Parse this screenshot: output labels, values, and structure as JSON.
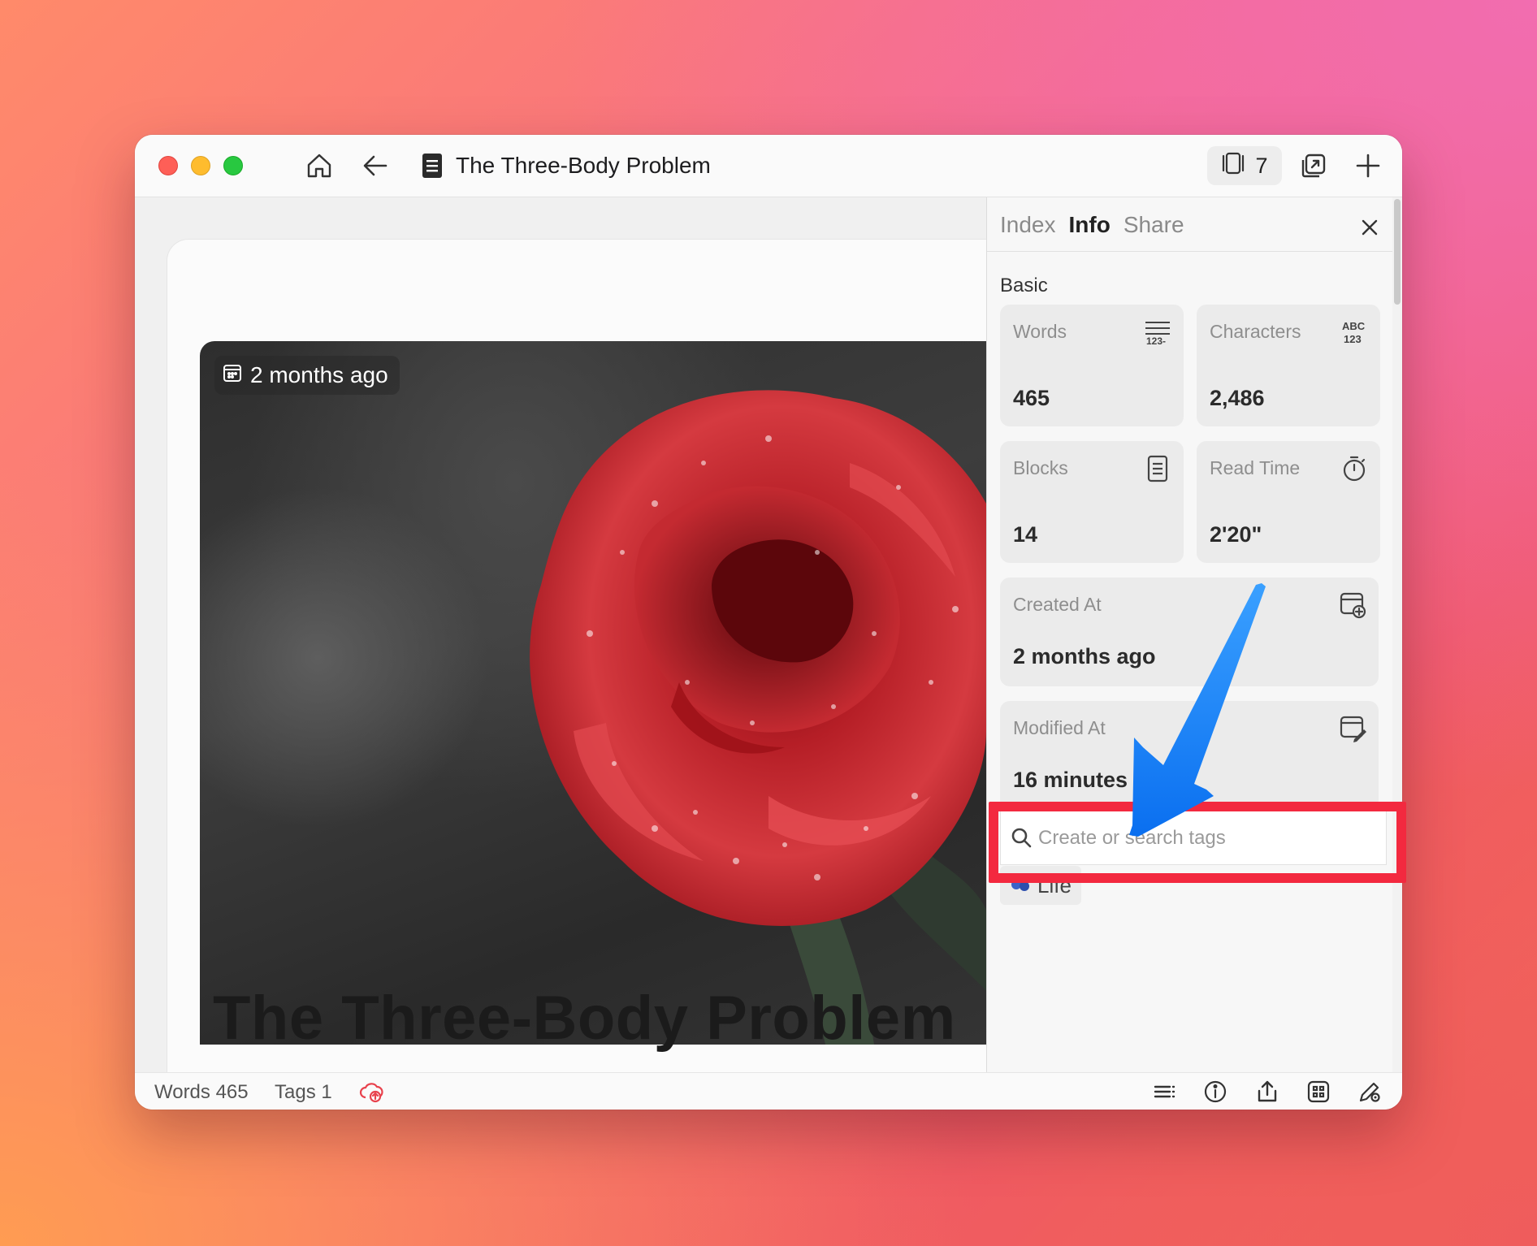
{
  "window": {
    "title": "The Three-Body Problem",
    "tab_count": "7"
  },
  "editor": {
    "date_chip": "2 months ago",
    "page_title": "The Three-Body Problem"
  },
  "statusbar": {
    "words": "Words 465",
    "tags": "Tags 1"
  },
  "panel": {
    "tabs": [
      "Index",
      "Info",
      "Share"
    ],
    "active_tab": "Info",
    "section": "Basic",
    "stats": [
      {
        "label": "Words",
        "value": "465",
        "icon": "word-count-icon"
      },
      {
        "label": "Characters",
        "value": "2,486",
        "icon": "character-count-icon"
      },
      {
        "label": "Blocks",
        "value": "14",
        "icon": "blocks-icon"
      },
      {
        "label": "Read Time",
        "value": "2'20\"",
        "icon": "timer-icon"
      }
    ],
    "created": {
      "label": "Created At",
      "value": "2 months ago"
    },
    "modified": {
      "label": "Modified At",
      "value": "16 minutes ago"
    },
    "tag_search_placeholder": "Create or search tags",
    "tags": [
      {
        "label": "Life",
        "icon": "blueberries-icon"
      }
    ]
  },
  "annotation": {
    "highlight_color": "#f3293f",
    "arrow_color": "#0a84ff"
  }
}
